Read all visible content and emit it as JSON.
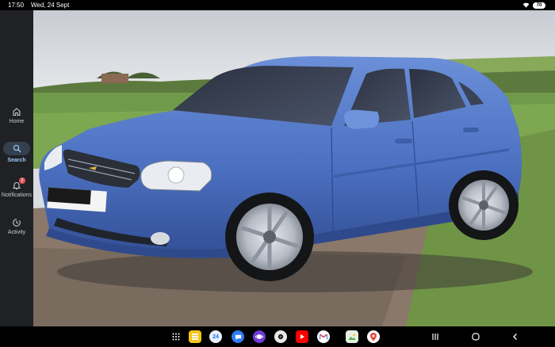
{
  "status_bar": {
    "time": "17:50",
    "date": "Wed, 24 Sept",
    "battery": "70"
  },
  "sidebar": {
    "items": [
      {
        "label": "Home",
        "icon": "home-icon",
        "active": false
      },
      {
        "label": "Search",
        "icon": "search-icon",
        "active": true
      },
      {
        "label": "Notifications",
        "icon": "bell-icon",
        "badge": "2",
        "active": false
      },
      {
        "label": "Activity",
        "icon": "clock-icon",
        "active": false
      }
    ]
  },
  "photo": {
    "subject": "blue-sedan-car",
    "plate_text": ""
  },
  "taskbar": {
    "apps": [
      {
        "name": "app-drawer",
        "icon": "grid-icon"
      },
      {
        "name": "notes",
        "icon": "notes-icon",
        "color": "#f5c518"
      },
      {
        "name": "calendar",
        "icon": "calendar-icon",
        "label": "24",
        "color": "#e8f0fe"
      },
      {
        "name": "messages",
        "icon": "chat-icon",
        "color": "#2f7bf6"
      },
      {
        "name": "internet",
        "icon": "planet-icon",
        "color": "#6f3bd6"
      },
      {
        "name": "camera",
        "icon": "camera-icon",
        "color": "#e8e8e8"
      },
      {
        "name": "youtube",
        "icon": "play-icon",
        "color": "#ff0000"
      },
      {
        "name": "gmail",
        "icon": "mail-icon",
        "color": "#ffffff"
      },
      {
        "name": "photos-edit",
        "icon": "gallery-icon",
        "color": "#e7efe2"
      },
      {
        "name": "maps",
        "icon": "map-pin-icon",
        "color": "#ffffff"
      }
    ],
    "colors": {
      "accent": "#9ec7ff",
      "car_blue": "#4f75c4"
    }
  }
}
